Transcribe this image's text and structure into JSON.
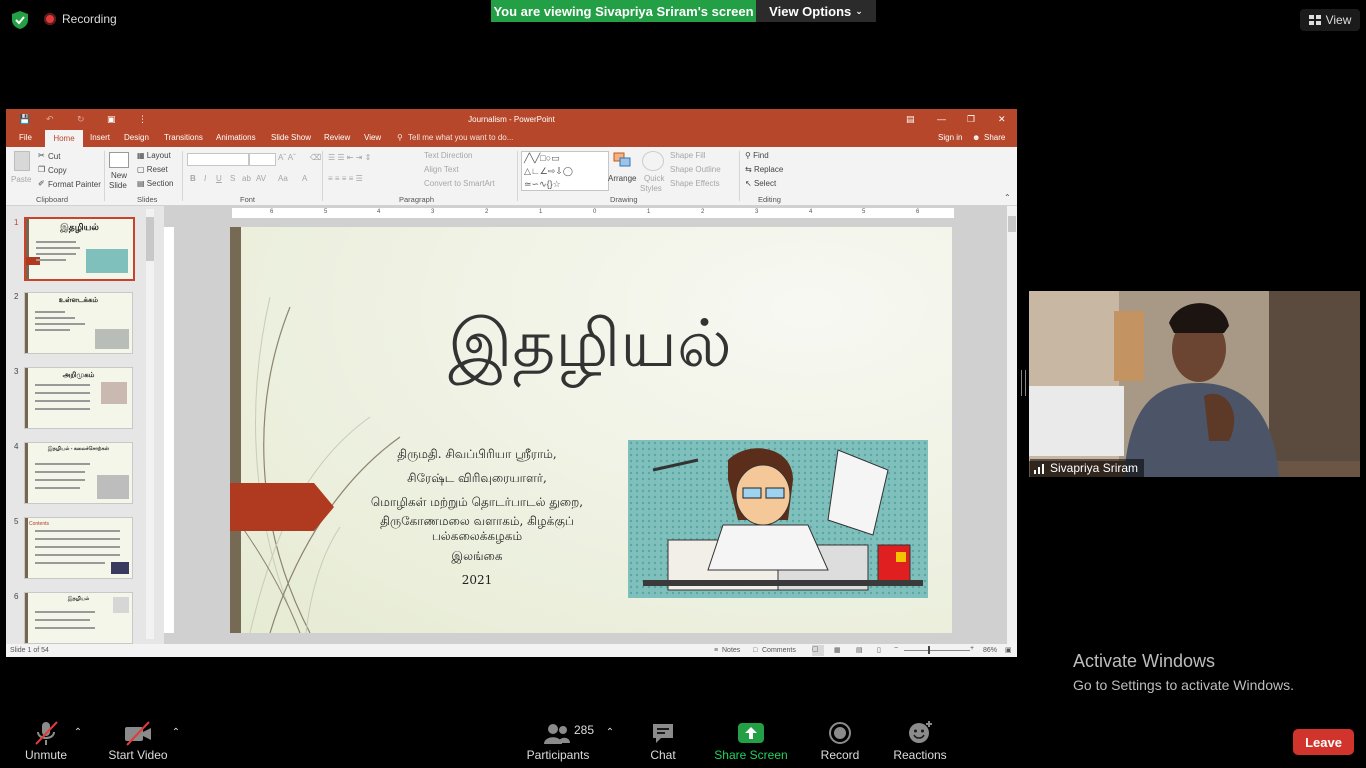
{
  "zoom": {
    "recording_label": "Recording",
    "viewing_banner": "You are viewing Sivapriya Sriram's screen",
    "view_options_label": "View Options",
    "view_label": "View",
    "participant_name": "Sivapriya Sriram",
    "toolbar": {
      "unmute": "Unmute",
      "start_video": "Start Video",
      "participants": "Participants",
      "participants_count": "285",
      "chat": "Chat",
      "share_screen": "Share Screen",
      "record": "Record",
      "reactions": "Reactions",
      "leave": "Leave"
    },
    "activate_title": "Activate Windows",
    "activate_sub": "Go to Settings to activate Windows.",
    "colors": {
      "share_green": "#23a045",
      "leave_red": "#d0342c",
      "ppt_orange": "#b7472a"
    }
  },
  "ppt": {
    "window_title": "Journalism - PowerPoint",
    "tabs": [
      "File",
      "Home",
      "Insert",
      "Design",
      "Transitions",
      "Animations",
      "Slide Show",
      "Review",
      "View"
    ],
    "tell_me": "Tell me what you want to do...",
    "sign_in": "Sign in",
    "share": "Share",
    "ribbon": {
      "paste": "Paste",
      "cut": "Cut",
      "copy": "Copy",
      "format_painter": "Format Painter",
      "clipboard": "Clipboard",
      "new_slide_1": "New",
      "new_slide_2": "Slide",
      "layout": "Layout",
      "reset": "Reset",
      "section": "Section",
      "slides": "Slides",
      "font": "Font",
      "text_direction": "Text Direction",
      "align_text": "Align Text",
      "convert_smartart": "Convert to SmartArt",
      "paragraph": "Paragraph",
      "arrange": "Arrange",
      "quick_styles_1": "Quick",
      "quick_styles_2": "Styles",
      "shape_fill": "Shape Fill",
      "shape_outline": "Shape Outline",
      "shape_effects": "Shape Effects",
      "drawing": "Drawing",
      "find": "Find",
      "replace": "Replace",
      "select": "Select",
      "editing": "Editing"
    },
    "thumbnails": [
      {
        "num": "1",
        "title": "இதழியல்"
      },
      {
        "num": "2",
        "title": "உள்ளடக்கம்"
      },
      {
        "num": "3",
        "title": "அறிமுகம்"
      },
      {
        "num": "4",
        "title": "இதழியல் - கலைச்சொற்கள்"
      },
      {
        "num": "5",
        "title": "Contents"
      },
      {
        "num": "6",
        "title": "இதழியல்"
      }
    ],
    "ruler_ticks": [
      "6",
      "5",
      "4",
      "3",
      "2",
      "1",
      "0",
      "1",
      "2",
      "3",
      "4",
      "5",
      "6"
    ],
    "slide": {
      "title": "இதழியல்",
      "lines": [
        "திருமதி. சிவப்பிரியா ஸ்ரீராம்,",
        "சிரேஷ்ட விரிவுரையாளர்,",
        "மொழிகள் மற்றும் தொடர்பாடல் துறை,",
        "திருகோணமலை வளாகம், கிழக்குப்",
        "பல்கலைக்கழகம்",
        "இலங்கை",
        "2021"
      ]
    },
    "status": {
      "slide_info": "Slide 1 of 54",
      "notes": "Notes",
      "comments": "Comments",
      "zoom": "86%"
    }
  }
}
